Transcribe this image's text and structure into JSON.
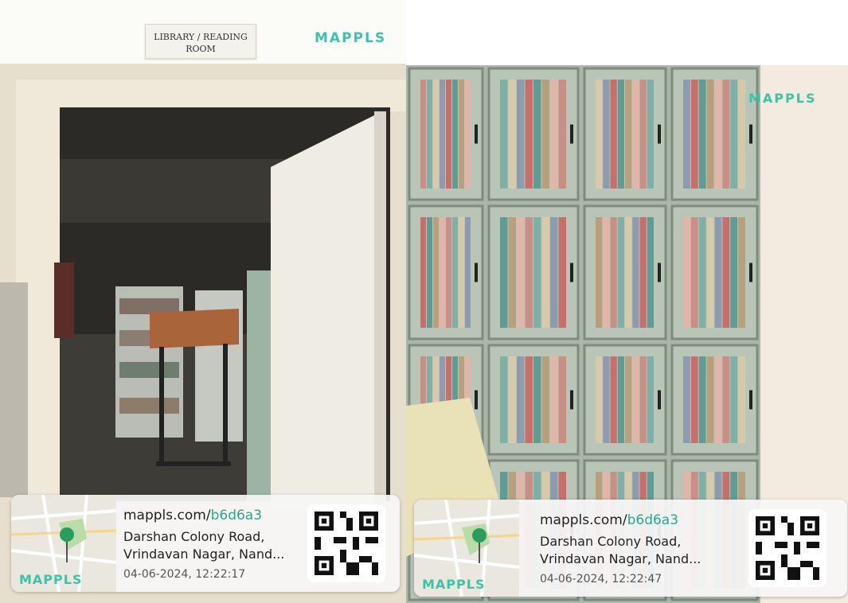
{
  "left_photo": {
    "sign_line1": "LIBRARY / READING",
    "sign_line2": "ROOM",
    "brand": "MAPPLS",
    "card": {
      "url_prefix": "mappls.com/",
      "url_code": "b6d6a3",
      "address_line1": "Darshan Colony Road,",
      "address_line2": "Vrindavan Nagar, Nand...",
      "timestamp": "04-06-2024, 12:22:17",
      "map_brand": "MAPPLS"
    }
  },
  "right_photo": {
    "brand": "MAPPLS",
    "card": {
      "url_prefix": "mappls.com/",
      "url_code": "b6d6a3",
      "address_line1": "Darshan Colony Road,",
      "address_line2": "Vrindavan Nagar, Nand...",
      "timestamp": "04-06-2024, 12:22:47",
      "map_brand": "MAPPLS"
    }
  },
  "colors": {
    "brand": "#3ec3a7",
    "link_code": "#27a88c",
    "cabinet": "#a9b6a8"
  }
}
